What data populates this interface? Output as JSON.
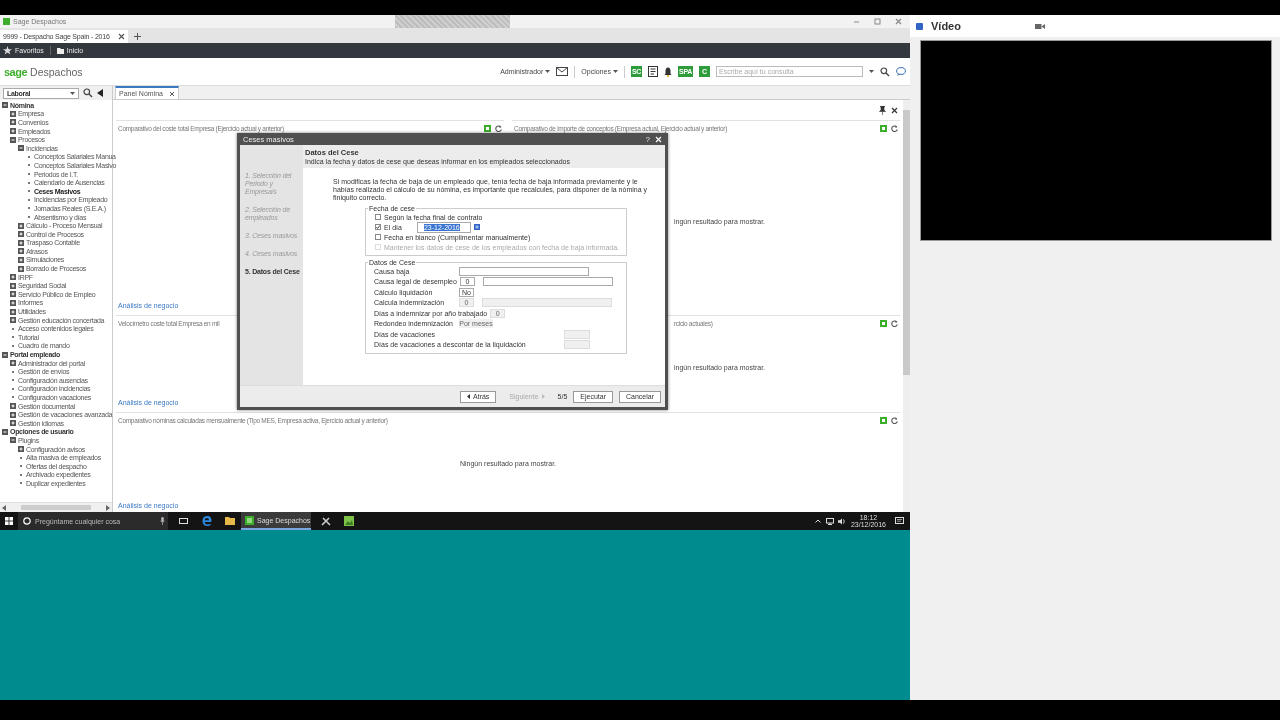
{
  "window": {
    "title": "Sage Despachos"
  },
  "browser_tab": {
    "label": "9999 - Despacho Sage Spain - 2016"
  },
  "favorites_bar": [
    {
      "kind": "favorites",
      "label": "Favoritos"
    },
    {
      "kind": "folder",
      "label": "Inicio"
    }
  ],
  "brand": {
    "logo": "sage",
    "name": "Despachos"
  },
  "header": {
    "user_menu": "Administrador",
    "options_menu": "Opciones",
    "badges": [
      "SC",
      "SPA",
      "C"
    ],
    "search": {
      "placeholder": "Escribe aquí tu consulta"
    }
  },
  "module_select": {
    "value": "Laboral"
  },
  "tree": [
    {
      "label": "Nómina",
      "kind": "folder",
      "expanded": true,
      "selected": false,
      "children": [
        {
          "label": "Empresa",
          "kind": "folder",
          "expanded": false,
          "selected": false
        },
        {
          "label": "Convenios",
          "kind": "folder",
          "expanded": false,
          "selected": false
        },
        {
          "label": "Empleados",
          "kind": "folder",
          "expanded": false,
          "selected": false
        },
        {
          "label": "Procesos",
          "kind": "folder",
          "expanded": true,
          "selected": false,
          "children": [
            {
              "label": "Incidencias",
              "kind": "folder",
              "expanded": true,
              "selected": false,
              "children": [
                {
                  "label": "Conceptos Salariales Manua",
                  "kind": "leaf",
                  "selected": false
                },
                {
                  "label": "Conceptos Salariales Masivo",
                  "kind": "leaf",
                  "selected": false
                },
                {
                  "label": "Periodos de I.T.",
                  "kind": "leaf",
                  "selected": false
                },
                {
                  "label": "Calendario de Ausencias",
                  "kind": "leaf",
                  "selected": false
                },
                {
                  "label": "Ceses Masivos",
                  "kind": "leaf",
                  "selected": true
                },
                {
                  "label": "Incidencias por Empleado",
                  "kind": "leaf",
                  "selected": false
                },
                {
                  "label": "Jornadas Reales (S.E.A.)",
                  "kind": "leaf",
                  "selected": false
                },
                {
                  "label": "Absentismo y días",
                  "kind": "leaf",
                  "selected": false
                }
              ]
            },
            {
              "label": "Cálculo - Proceso Mensual",
              "kind": "folder",
              "expanded": false,
              "selected": false
            },
            {
              "label": "Control de Procesos",
              "kind": "folder",
              "expanded": false,
              "selected": false
            },
            {
              "label": "Traspaso Contable",
              "kind": "folder",
              "expanded": false,
              "selected": false
            },
            {
              "label": "Atrasos",
              "kind": "folder",
              "expanded": false,
              "selected": false
            },
            {
              "label": "Simulaciones",
              "kind": "folder",
              "expanded": false,
              "selected": false
            },
            {
              "label": "Borrado de Procesos",
              "kind": "folder",
              "expanded": false,
              "selected": false
            }
          ]
        },
        {
          "label": "IRPF",
          "kind": "folder",
          "expanded": false,
          "selected": false
        },
        {
          "label": "Seguridad Social",
          "kind": "folder",
          "expanded": false,
          "selected": false
        },
        {
          "label": "Servicio Público de Empleo",
          "kind": "folder",
          "expanded": false,
          "selected": false
        },
        {
          "label": "Informes",
          "kind": "folder",
          "expanded": false,
          "selected": false
        },
        {
          "label": "Utilidades",
          "kind": "folder",
          "expanded": false,
          "selected": false
        },
        {
          "label": "Gestión educación concertada",
          "kind": "folder",
          "expanded": false,
          "selected": false
        },
        {
          "label": "Acceso contenidos legales",
          "kind": "leaf",
          "selected": false
        },
        {
          "label": "Tutorial",
          "kind": "leaf",
          "selected": false
        },
        {
          "label": "Cuadro de mando",
          "kind": "leaf",
          "selected": false
        }
      ]
    },
    {
      "label": "Portal empleado",
      "kind": "folder",
      "expanded": true,
      "selected": false,
      "children": [
        {
          "label": "Administrador del portal",
          "kind": "folder",
          "expanded": false,
          "selected": false
        },
        {
          "label": "Gestión de envíos",
          "kind": "leaf",
          "selected": false
        },
        {
          "label": "Configuración ausencias",
          "kind": "leaf",
          "selected": false
        },
        {
          "label": "Configuración incidencias",
          "kind": "leaf",
          "selected": false
        },
        {
          "label": "Configuración vacaciones",
          "kind": "leaf",
          "selected": false
        },
        {
          "label": "Gestión documental",
          "kind": "folder",
          "expanded": false,
          "selected": false
        },
        {
          "label": "Gestión de vacaciones avanzada",
          "kind": "folder",
          "expanded": false,
          "selected": false
        },
        {
          "label": "Gestión idiomas",
          "kind": "folder",
          "expanded": false,
          "selected": false
        }
      ]
    },
    {
      "label": "Opciones de usuario",
      "kind": "folder",
      "expanded": true,
      "selected": false,
      "children": [
        {
          "label": "Plugins",
          "kind": "folder",
          "expanded": true,
          "selected": false,
          "children": [
            {
              "label": "Configuración avisos",
              "kind": "folder",
              "expanded": false,
              "selected": false
            },
            {
              "label": "Alta masiva de empleados",
              "kind": "leaf",
              "selected": false
            },
            {
              "label": "Ofertas del despacho",
              "kind": "leaf",
              "selected": false
            },
            {
              "label": "Archivado expedientes",
              "kind": "leaf",
              "selected": false
            },
            {
              "label": "Duplicar expedientes",
              "kind": "leaf",
              "selected": false
            }
          ]
        }
      ]
    }
  ],
  "tabs": [
    {
      "label": "Panel Nómina",
      "selected": true
    }
  ],
  "panels": [
    {
      "title": "Comparativo del coste total Empresa (Ejercicio actual y anterior)",
      "link": "Análisis de negocio"
    },
    {
      "title": "Comparativo de importe de conceptos (Empresa actual, Ejercicio actual y anterior)",
      "message": "ingún resultado para mostrar."
    },
    {
      "title": "Velocímetro coste total Empresa en mil",
      "link": "Análisis de negocio"
    },
    {
      "title": "rcicio actuales)",
      "message": "ingún resultado para mostrar."
    },
    {
      "title": "Comparativo nóminas calculadas mensualmente (Tipo MES, Empresa activa, Ejercicio actual y anterior)",
      "message": "Ningún resultado para mostrar.",
      "link": "Análisis de negocio"
    }
  ],
  "dialog": {
    "title": "Ceses masivos",
    "help": "?",
    "heading": "Datos del Cese",
    "subheading": "Indica la fecha y datos de cese que deseas informar en los empleados seleccionados",
    "steps": [
      {
        "label": "1. Selección del Periodo y Empresa/s",
        "selected": false
      },
      {
        "label": "2. Selección de empleados",
        "selected": false
      },
      {
        "label": "3. Ceses masivos",
        "selected": false
      },
      {
        "label": "4. Ceses masivos",
        "selected": false
      },
      {
        "label": "5. Datos del Cese",
        "selected": true
      }
    ],
    "notice": "Si modificas la fecha de baja de un empleado que, tenía fecha de baja informada previamente y le habías realizado el cálculo de su nómina, es importante que recalcules, para disponer de la nómina y finiquito correcto.",
    "date_group": {
      "title": "Fecha de cese",
      "options": [
        {
          "kind": "check",
          "label": "Según la fecha final de contrato",
          "checked": false,
          "disabled": false
        },
        {
          "kind": "date",
          "label": "El día",
          "checked": true,
          "disabled": false,
          "value": "23-12-2016",
          "value_selected": true
        },
        {
          "kind": "check",
          "label": "Fecha en blanco (Cumplimentar manualmente)",
          "checked": false,
          "disabled": false
        },
        {
          "kind": "check",
          "label": "Mantener los datos de cese de los empleados con fecha de baja informada.",
          "checked": false,
          "disabled": true
        }
      ]
    },
    "data_group": {
      "title": "Datos de Cese",
      "fields": [
        {
          "label": "Causa baja",
          "inputs": [
            {
              "kind": "wide",
              "disabled": false
            }
          ]
        },
        {
          "label": "Causa legal de desempleo",
          "inputs": [
            {
              "kind": "code",
              "value": "0",
              "disabled": false
            },
            {
              "kind": "wide",
              "disabled": false
            }
          ]
        },
        {
          "label": "Cálculo liquidación",
          "inputs": [
            {
              "kind": "code",
              "value": "No",
              "disabled": false
            }
          ]
        },
        {
          "label": "Calcula indemnización",
          "inputs": [
            {
              "kind": "code",
              "value": "0",
              "disabled": true
            },
            {
              "kind": "wide",
              "disabled": true
            }
          ]
        },
        {
          "label": "Días a indemnizar por año trabajado",
          "inputs": [
            {
              "kind": "code",
              "value": "0",
              "disabled": true
            }
          ]
        },
        {
          "label": "Redondeo indemnización",
          "inputs": [
            {
              "kind": "combo",
              "value": "Por meses",
              "disabled": true
            }
          ]
        },
        {
          "label": "Días de vacaciones",
          "inputs": [
            {
              "kind": "short",
              "disabled": true
            }
          ]
        },
        {
          "label": "Días de vacaciones a descontar de la liquidación",
          "inputs": [
            {
              "kind": "short",
              "disabled": true
            }
          ]
        }
      ]
    },
    "buttons": [
      {
        "kind": "back",
        "label": "Atrás",
        "disabled": false
      },
      {
        "kind": "next",
        "label": "Siguiente",
        "disabled": true
      },
      {
        "kind": "counter",
        "label": "5/5"
      },
      {
        "kind": "plain",
        "label": "Ejecutar",
        "disabled": false
      },
      {
        "kind": "plain",
        "label": "Cancelar",
        "disabled": false
      }
    ]
  },
  "taskbar": {
    "search_placeholder": "Pregúntame cualquier cosa",
    "apps": [
      {
        "label": "Sage Despachos",
        "selected": true
      }
    ],
    "time": "18:12",
    "date": "23/12/2016"
  },
  "video_panel": {
    "title": "Vídeo"
  }
}
